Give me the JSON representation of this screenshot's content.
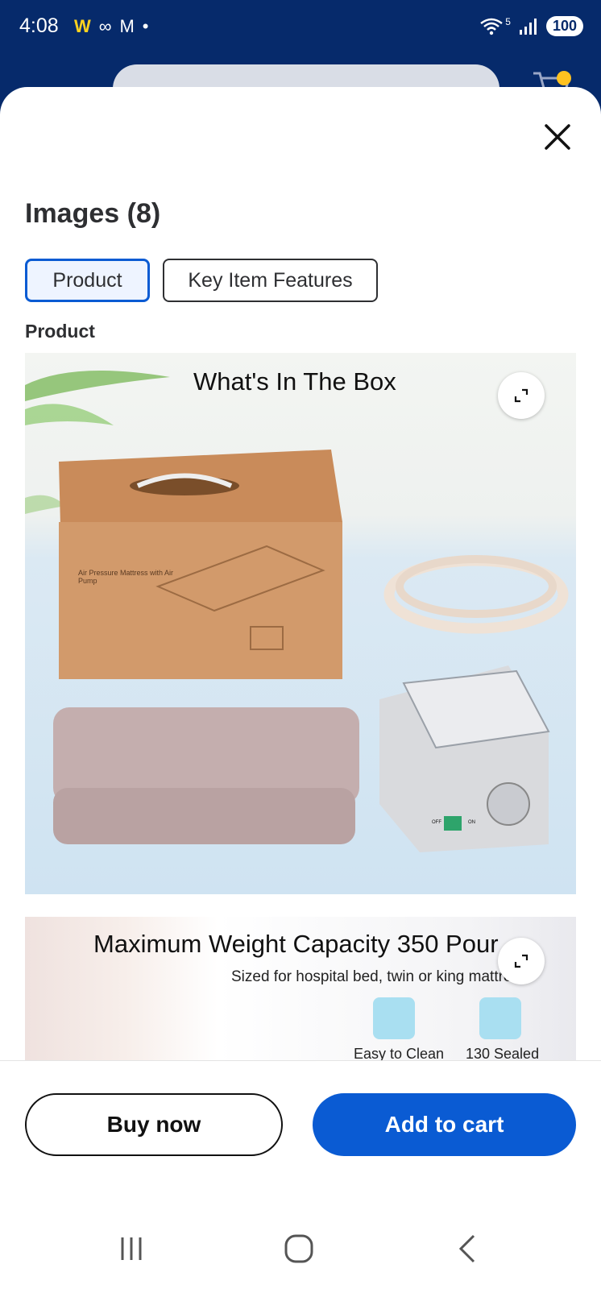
{
  "status_bar": {
    "time": "4:08",
    "battery": "100",
    "network": "5"
  },
  "sheet": {
    "title": "Images (8)",
    "tabs": [
      {
        "label": "Product",
        "active": true
      },
      {
        "label": "Key Item Features",
        "active": false
      }
    ],
    "section_heading": "Product",
    "images": [
      {
        "caption": "What's In The Box",
        "box_text": "Air Pressure Mattress with Air Pump",
        "pump_switch_off": "OFF",
        "pump_switch_on": "ON"
      },
      {
        "caption": "Maximum Weight Capacity 350 Pour",
        "subcaption": "Sized for hospital bed, twin or king mattre",
        "feature_1": "Easy to Clean",
        "feature_2": "130 Sealed"
      }
    ]
  },
  "actions": {
    "buy_now": "Buy now",
    "add_to_cart": "Add to cart"
  },
  "colors": {
    "header_bg": "#062a6b",
    "accent": "#0a5bd3"
  },
  "icons": [
    "close-icon",
    "expand-icon",
    "wifi-icon",
    "signal-icon",
    "cart-icon",
    "recent-apps-icon",
    "home-icon",
    "back-icon"
  ]
}
